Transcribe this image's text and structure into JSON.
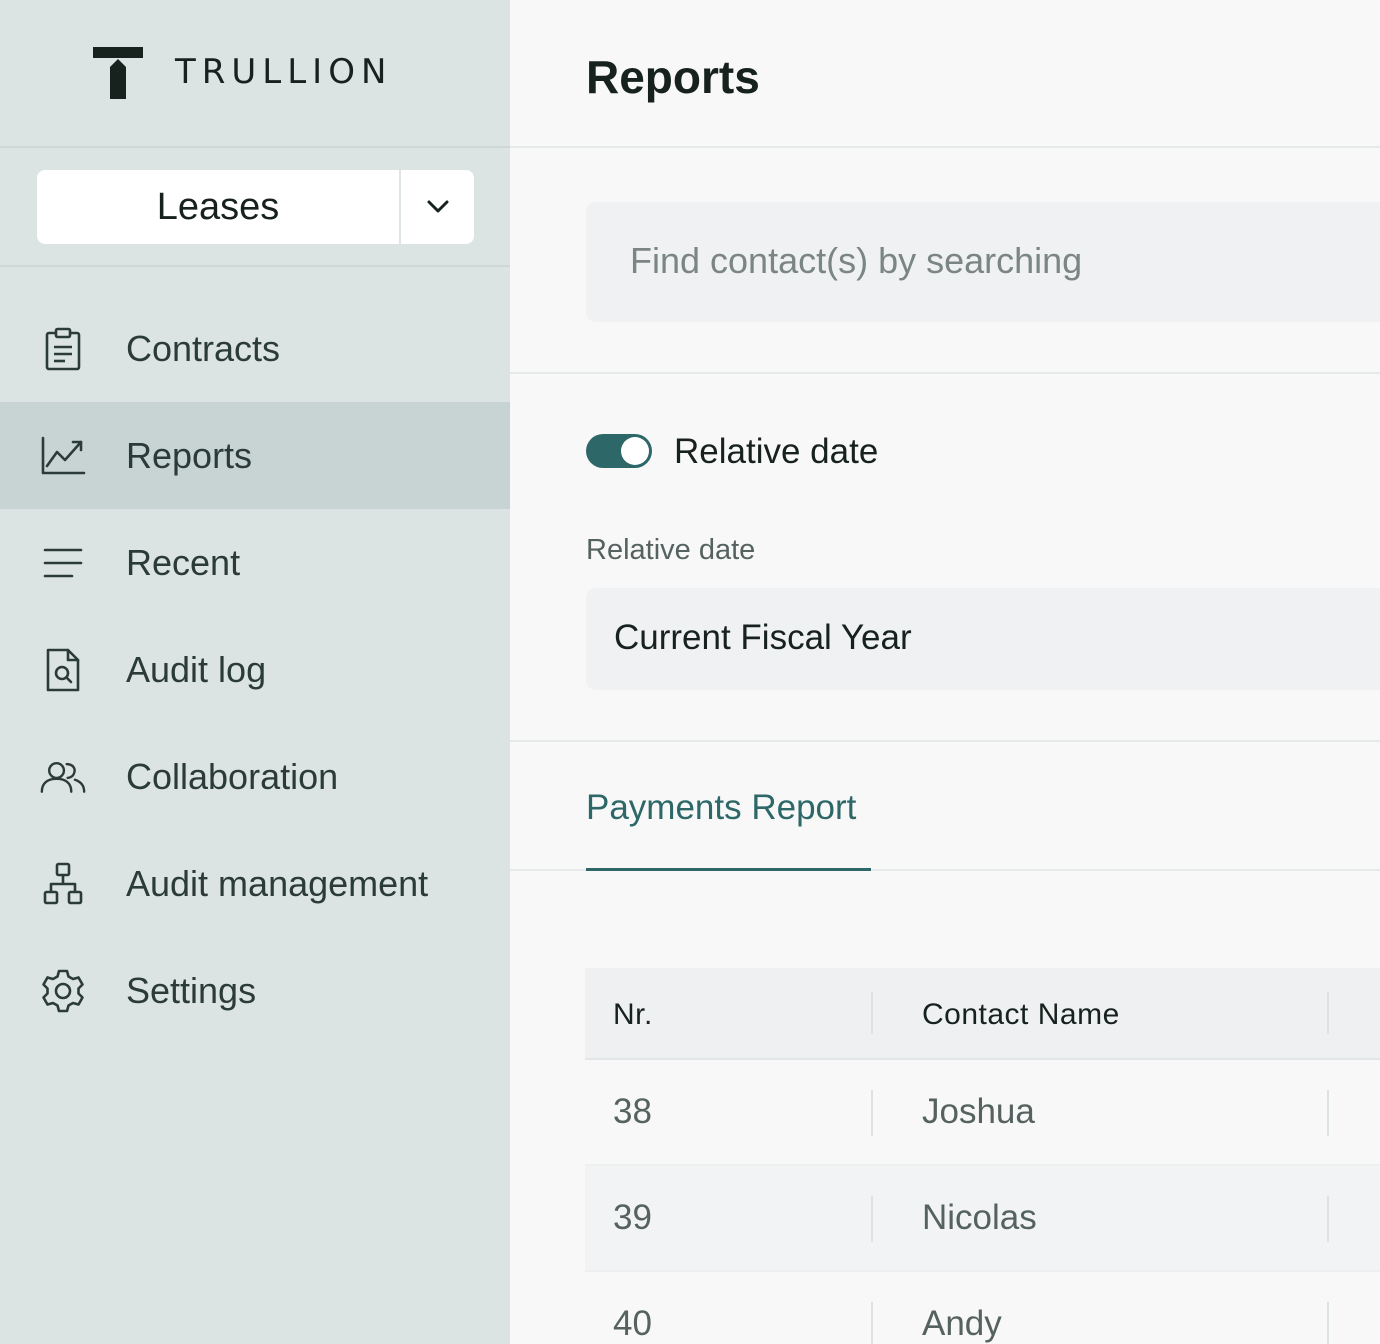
{
  "brand": {
    "name": "TRULLION"
  },
  "product_selector": {
    "value": "Leases"
  },
  "sidebar": {
    "items": [
      {
        "label": "Contracts",
        "icon": "clipboard-icon",
        "active": false
      },
      {
        "label": "Reports",
        "icon": "chart-line-icon",
        "active": true
      },
      {
        "label": "Recent",
        "icon": "lines-icon",
        "active": false
      },
      {
        "label": "Audit log",
        "icon": "document-search-icon",
        "active": false
      },
      {
        "label": "Collaboration",
        "icon": "users-icon",
        "active": false
      },
      {
        "label": "Audit management",
        "icon": "hierarchy-icon",
        "active": false
      },
      {
        "label": "Settings",
        "icon": "gear-icon",
        "active": false
      }
    ]
  },
  "header": {
    "title": "Reports"
  },
  "search": {
    "placeholder": "Find contact(s) by searching",
    "value": ""
  },
  "relative_date_toggle": {
    "label": "Relative date",
    "on": true
  },
  "relative_date_field": {
    "label": "Relative date",
    "value": "Current Fiscal Year"
  },
  "tabs": [
    {
      "label": "Payments Report",
      "active": true
    }
  ],
  "table": {
    "columns": [
      "Nr.",
      "Contact Name"
    ],
    "rows": [
      {
        "nr": "38",
        "name": "Joshua"
      },
      {
        "nr": "39",
        "name": "Nicolas"
      },
      {
        "nr": "40",
        "name": "Andy"
      }
    ]
  },
  "colors": {
    "accent": "#2e6767",
    "sidebar_bg": "#dce4e3",
    "sidebar_active": "#c7d4d3"
  }
}
